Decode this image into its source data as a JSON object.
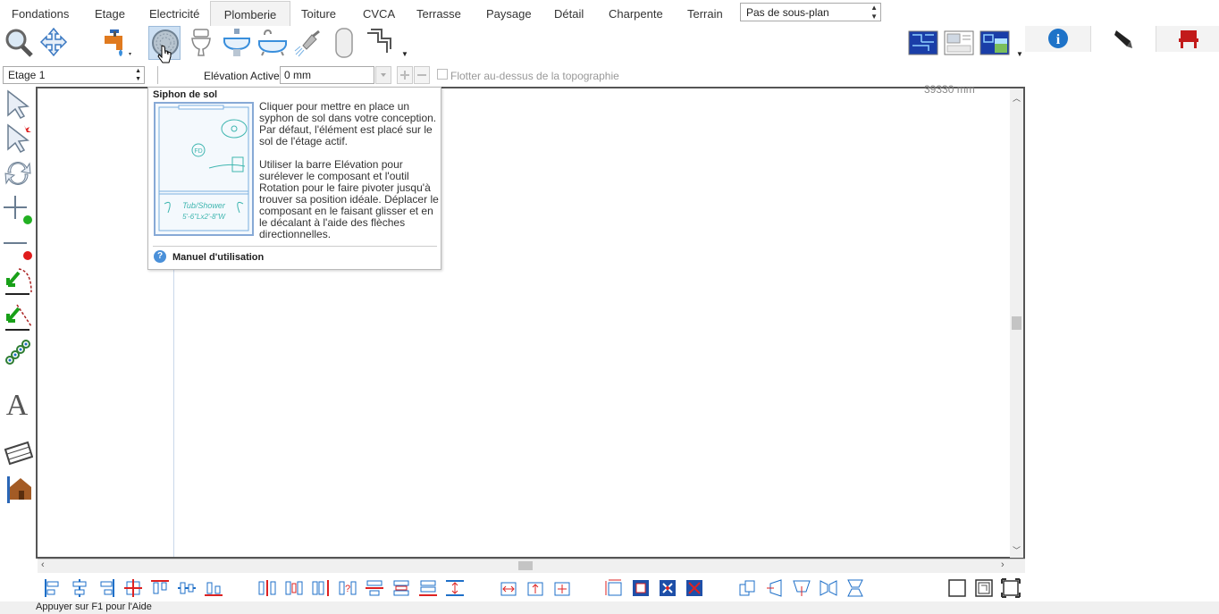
{
  "tabs": [
    {
      "label": "Fondations",
      "active": false
    },
    {
      "label": "Etage",
      "active": false
    },
    {
      "label": "Electricité",
      "active": false
    },
    {
      "label": "Plomberie",
      "active": true
    },
    {
      "label": "Toiture",
      "active": false
    },
    {
      "label": "CVCA",
      "active": false
    },
    {
      "label": "Terrasse",
      "active": false
    },
    {
      "label": "Paysage",
      "active": false
    },
    {
      "label": "Détail",
      "active": false
    },
    {
      "label": "Charpente",
      "active": false
    },
    {
      "label": "Terrain",
      "active": false
    }
  ],
  "subplan": {
    "value": "Pas de sous-plan"
  },
  "elevation_bar": {
    "floor": "Etage 1",
    "elevation_label": "Elévation Active:",
    "elevation_value": "0 mm",
    "float_label": "Flotter au-dessus de la topographie"
  },
  "canvas": {
    "dimension_text": "39330 mm"
  },
  "tooltip": {
    "title": "Siphon de sol",
    "paragraph1": "Cliquer pour mettre en place un syphon de sol dans votre conception. Par défaut, l'élément est placé sur le sol de l'étage actif.",
    "paragraph2": "Utiliser la barre Elévation pour surélever le composant et l'outil Rotation pour le faire pivoter jusqu'à trouver sa position idéale. Déplacer le composant en le faisant glisser et en le décalant à l'aide des flèches directionnelles.",
    "image_label_fd": "FD",
    "image_label_tub": "Tub/Shower",
    "image_label_size": "5'-6\"Lx2'-8\"W",
    "manual_link": "Manuel d'utilisation"
  },
  "status_bar": {
    "text": "Appuyer sur F1 pour l'Aide"
  },
  "colors": {
    "accent": "#1e73c8",
    "tab_active_bg": "#f3f3f3",
    "selected_tool_bg": "#cde0f3",
    "plan_blue": "#1a3ea8"
  }
}
